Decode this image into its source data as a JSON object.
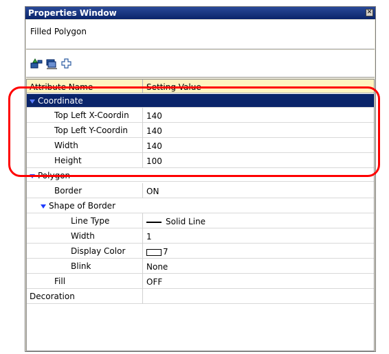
{
  "window": {
    "title": "Properties Window",
    "close_glyph": "✕"
  },
  "object_name": "Filled Polygon",
  "toolbar": [
    "sort-category-icon",
    "sort-alpha-icon",
    "expand-icon"
  ],
  "grid": {
    "header_name": "Attribute Name",
    "header_value": "Setting Value",
    "coordinate": {
      "label": "Coordinate",
      "rows": [
        {
          "name": "Top Left X-Coordin",
          "value": "140"
        },
        {
          "name": "Top Left Y-Coordin",
          "value": "140"
        },
        {
          "name": "Width",
          "value": "140"
        },
        {
          "name": "Height",
          "value": "100"
        }
      ]
    },
    "polygon": {
      "label": "Polygon",
      "border": {
        "name": "Border",
        "value": "ON"
      },
      "shape_of_border": {
        "label": "Shape of Border",
        "line_type": {
          "name": "Line Type",
          "value": "Solid Line"
        },
        "width": {
          "name": "Width",
          "value": "1"
        },
        "display_color": {
          "name": "Display Color",
          "value": "7"
        },
        "blink": {
          "name": "Blink",
          "value": "None"
        }
      },
      "fill": {
        "name": "Fill",
        "value": "OFF"
      }
    },
    "decoration": {
      "name": "Decoration",
      "value": ""
    }
  },
  "colors": {
    "highlight": "#ff0000",
    "category_bg": "#0a246a",
    "header_bg": "#fff4c0"
  }
}
